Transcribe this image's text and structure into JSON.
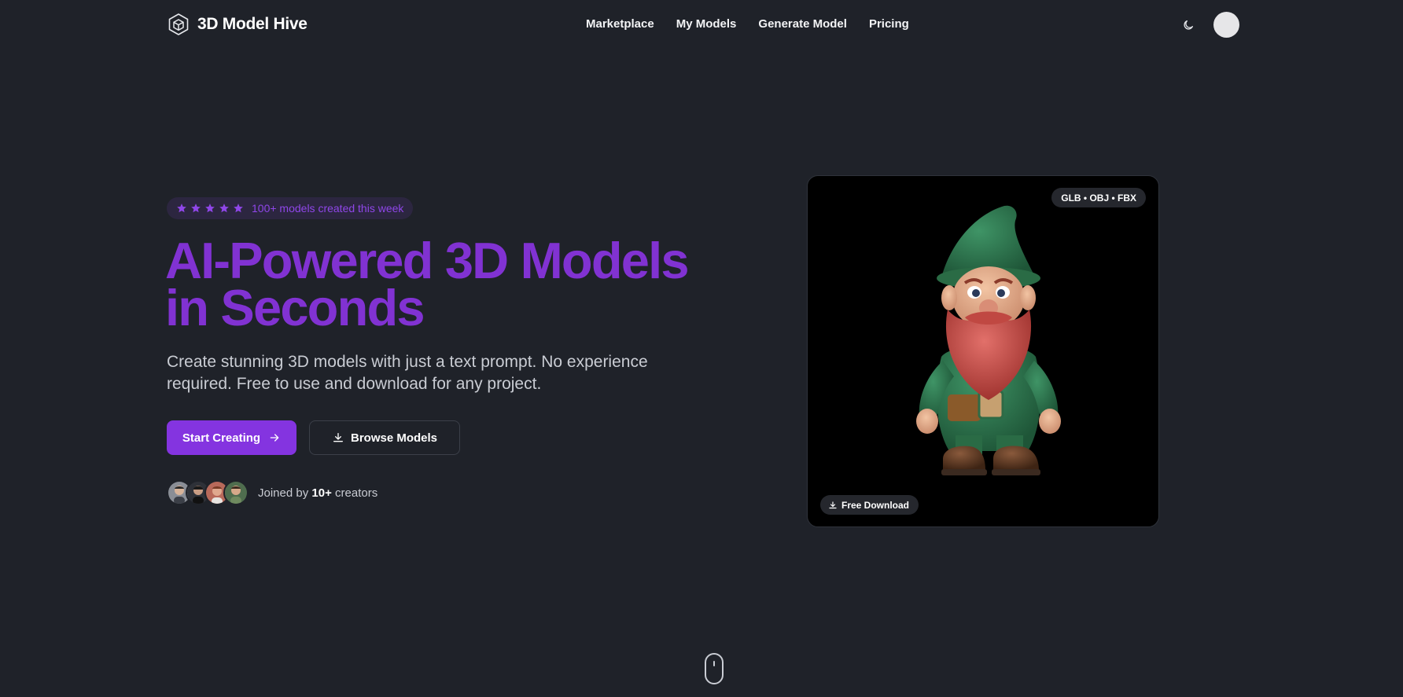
{
  "header": {
    "brand": "3D Model Hive",
    "nav": [
      "Marketplace",
      "My Models",
      "Generate Model",
      "Pricing"
    ]
  },
  "hero": {
    "badge_text": "100+ models created this week",
    "star_count": 5,
    "title_line1": "AI-Powered 3D Models",
    "title_line2": "in Seconds",
    "subtitle": "Create stunning 3D models with just a text prompt. No experience required. Free to use and download for any project.",
    "primary_button": "Start Creating",
    "secondary_button": "Browse Models",
    "creators_prefix": "Joined by ",
    "creators_count": "10+",
    "creators_suffix": " creators"
  },
  "preview": {
    "formats": "GLB • OBJ • FBX",
    "download_label": "Free Download"
  },
  "colors": {
    "background": "#1f2229",
    "accent": "#8434e0",
    "title": "#8132d2"
  }
}
